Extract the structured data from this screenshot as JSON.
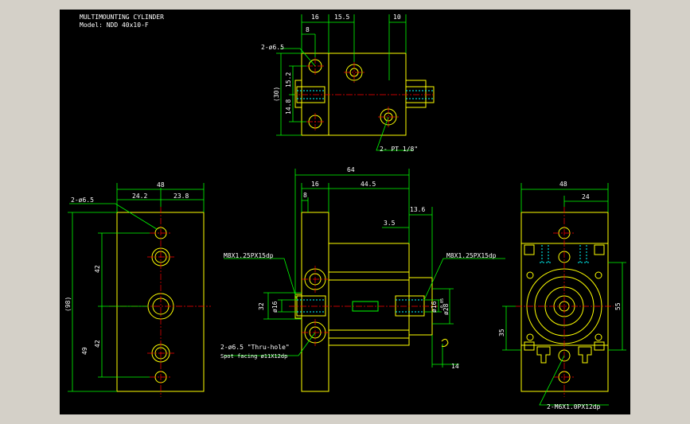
{
  "title": {
    "line1": "MULTIMOUNTING CYLINDER",
    "line2": "Model: NDD 40x10-F"
  },
  "colors": {
    "background": "#000000",
    "frame": "#d4d0c8",
    "outline": "#ffff00",
    "dimension": "#00ff00",
    "centerline": "#ff0000",
    "hole": "#ff4040",
    "hidden": "#00ffff",
    "text": "#ffffff"
  },
  "top_view": {
    "dims": {
      "d16": "16",
      "d15_5": "15.5",
      "d10": "10",
      "d8": "8",
      "d30": "(30)",
      "d15_2": "15.2",
      "d14_8": "14.8"
    },
    "callouts": {
      "holes": "2-ø6.5",
      "ports": "2- PT 1/8\""
    }
  },
  "left_view": {
    "dims": {
      "d48": "48",
      "d24_2": "24.2",
      "d23_8": "23.8",
      "d98": "(98)",
      "d42a": "42",
      "d42b": "42",
      "d49": "49"
    },
    "callouts": {
      "holes": "2-ø6.5"
    }
  },
  "front_view": {
    "dims": {
      "d64": "64",
      "d16": "16",
      "d44_5": "44.5",
      "d8": "8",
      "d13_6": "13.6",
      "d3_5": "3.5",
      "d32": "32",
      "d16a": "ø16",
      "d16b": "ø16",
      "d28": "ø28",
      "d28_tol": "-0.05",
      "d14": "14"
    },
    "callouts": {
      "thread_left": "M8X1.25PX15dp",
      "thread_right": "M8X1.25PX15dp",
      "thru1": "2-ø6.5 \"Thru-hole\"",
      "thru2": "Spot facing ø11X12dp"
    }
  },
  "end_view": {
    "dims": {
      "d48": "48",
      "d24": "24",
      "d55": "55",
      "d35": "35"
    },
    "callouts": {
      "thread": "2-M6X1.0PX12dp"
    }
  }
}
